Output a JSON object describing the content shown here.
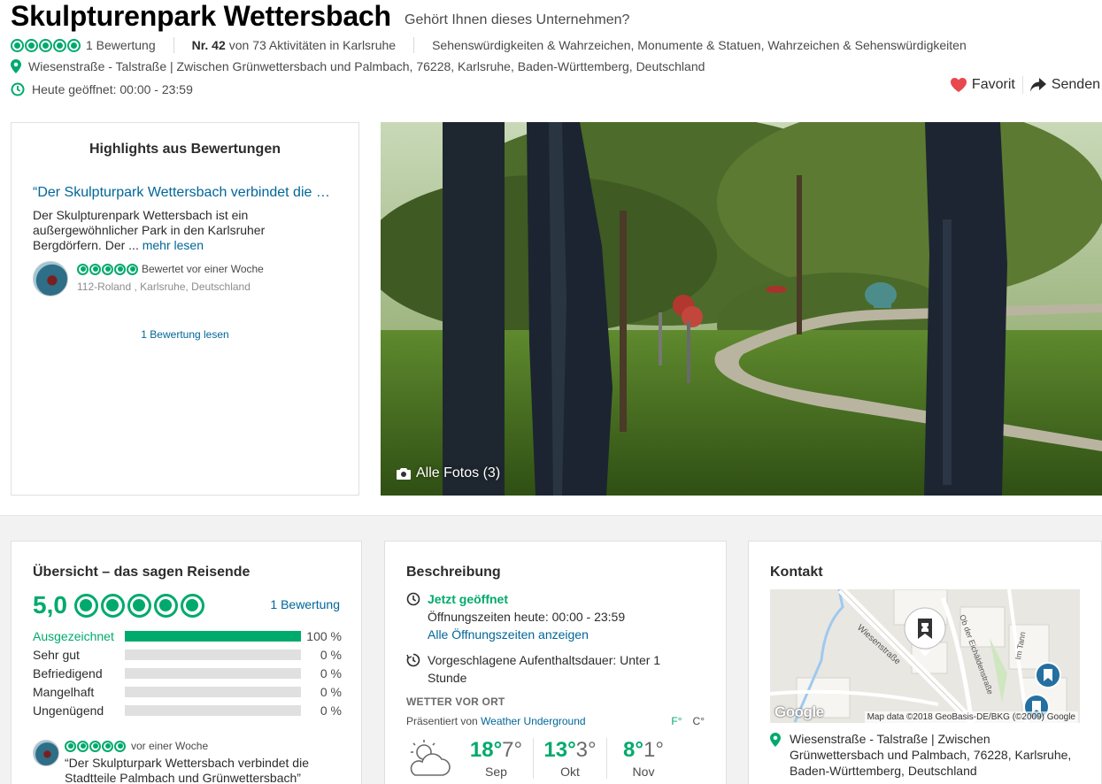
{
  "header": {
    "title": "Skulpturenpark Wettersbach",
    "claim": "Gehört Ihnen dieses Unternehmen?",
    "review_count": "1 Bewertung",
    "rank_prefix": "Nr. 42",
    "rank_suffix": "von 73 Aktivitäten in Karlsruhe",
    "categories": "Sehenswürdigkeiten & Wahrzeichen, Monumente & Statuen, Wahrzeichen & Sehenswürdigkeiten",
    "address": "Wiesenstraße - Talstraße | Zwischen Grünwettersbach und Palmbach, 76228, Karlsruhe, Baden-Württemberg, Deutschland",
    "hours": "Heute geöffnet: 00:00 - 23:59",
    "favorite_label": "Favorit",
    "share_label": "Senden",
    "rating_bubbles": 5
  },
  "highlights": {
    "title": "Highlights aus Bewertungen",
    "quote": "“Der Skulpturpark Wettersbach verbindet die …",
    "text": "Der Skulpturenpark Wettersbach ist ein außergewöhnlicher Park in den Karlsruher Bergdörfern. Der ...",
    "more_link": "mehr lesen",
    "reviewed_when": "Bewertet vor einer Woche",
    "reviewer": "112-Roland  , Karlsruhe, Deutschland",
    "read_link": "1 Bewertung lesen"
  },
  "photo": {
    "label": "Alle Fotos (3)"
  },
  "overview": {
    "title": "Übersicht – das sagen Reisende",
    "score": "5,0",
    "count_link": "1 Bewertung",
    "distribution": [
      {
        "label": "Ausgezeichnet",
        "value": 100,
        "pct": "100 %"
      },
      {
        "label": "Sehr gut",
        "value": 0,
        "pct": "0 %"
      },
      {
        "label": "Befriedigend",
        "value": 0,
        "pct": "0 %"
      },
      {
        "label": "Mangelhaft",
        "value": 0,
        "pct": "0 %"
      },
      {
        "label": "Ungenügend",
        "value": 0,
        "pct": "0 %"
      }
    ],
    "review_when": "vor einer Woche",
    "review_quote": "“Der Skulpturpark Wettersbach verbindet die Stadtteile Palmbach und Grünwettersbach”"
  },
  "description": {
    "title": "Beschreibung",
    "open_now": "Jetzt geöffnet",
    "hours_today": "Öffnungszeiten heute: 00:00 - 23:59",
    "all_hours_link": "Alle Öffnungszeiten anzeigen",
    "duration": "Vorgeschlagene Aufenthaltsdauer: Unter 1 Stunde",
    "weather_heading": "WETTER VOR ORT",
    "weather_presented": "Präsentiert von",
    "weather_source": "Weather Underground",
    "unit_f": "F°",
    "unit_c": "C°",
    "forecast": [
      {
        "hi": "18°",
        "lo": "7°",
        "month": "Sep"
      },
      {
        "hi": "13°",
        "lo": "3°",
        "month": "Okt"
      },
      {
        "hi": "8°",
        "lo": "1°",
        "month": "Nov"
      }
    ]
  },
  "contact": {
    "title": "Kontakt",
    "map_attribution": "Map data ©2018 GeoBasis-DE/BKG (©2009) Google",
    "google_logo": "Google",
    "street_label_1": "Wiesenstraße",
    "street_label_2": "Ob der Eichäldenstraße",
    "street_label_3": "Im Tann",
    "address": "Wiesenstraße - Talstraße | Zwischen Grünwettersbach und Palmbach, 76228, Karlsruhe, Baden-Württemberg, Deutschland"
  },
  "colors": {
    "brand_green": "#00aa6c",
    "link_blue": "#006699",
    "heart_red": "#e8474e"
  }
}
